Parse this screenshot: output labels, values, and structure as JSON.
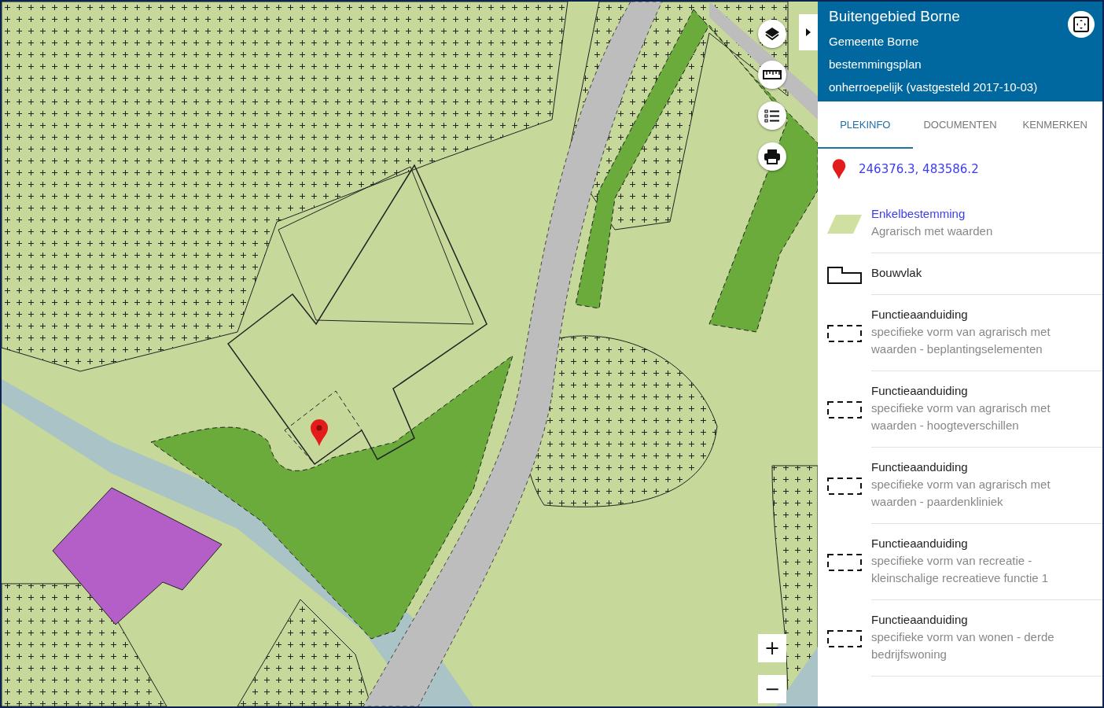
{
  "map": {
    "controls": [
      {
        "kind": "layers"
      },
      {
        "kind": "ruler"
      },
      {
        "kind": "list"
      },
      {
        "kind": "print"
      }
    ],
    "zoom": {
      "in": "+",
      "out": "−"
    }
  },
  "panel": {
    "title": "Buitengebied Borne",
    "lines": [
      "Gemeente Borne",
      "bestemmingsplan",
      "onherroepelijk (vastgesteld 2017-10-03)"
    ],
    "tabs": [
      {
        "label": "PLEKINFO",
        "selected": true
      },
      {
        "label": "DOCUMENTEN",
        "selected": false
      },
      {
        "label": "KENMERKEN",
        "selected": false
      }
    ],
    "coordinates": "246376.3, 483586.2",
    "legend": [
      {
        "kind": "fill",
        "title": "Enkelbestemming",
        "link": true,
        "subtitle": "Agrarisch met waarden"
      },
      {
        "kind": "outline",
        "title": "Bouwvlak",
        "link": false
      },
      {
        "kind": "dashed",
        "title": "Functieaanduiding",
        "link": false,
        "subtitle": "specifieke vorm van agrarisch met waarden - beplantingselementen"
      },
      {
        "kind": "dashed",
        "title": "Functieaanduiding",
        "link": false,
        "subtitle": "specifieke vorm van agrarisch met waarden - hoogteverschillen"
      },
      {
        "kind": "dashed",
        "title": "Functieaanduiding",
        "link": false,
        "subtitle": "specifieke vorm van agrarisch met waarden - paardenkliniek"
      },
      {
        "kind": "dashed",
        "title": "Functieaanduiding",
        "link": false,
        "subtitle": "specifieke vorm van recreatie - kleinschalige recreatieve functie 1"
      },
      {
        "kind": "dashed",
        "title": "Functieaanduiding",
        "link": false,
        "subtitle": "specifieke vorm van wonen - derde bedrijfswoning"
      }
    ]
  }
}
